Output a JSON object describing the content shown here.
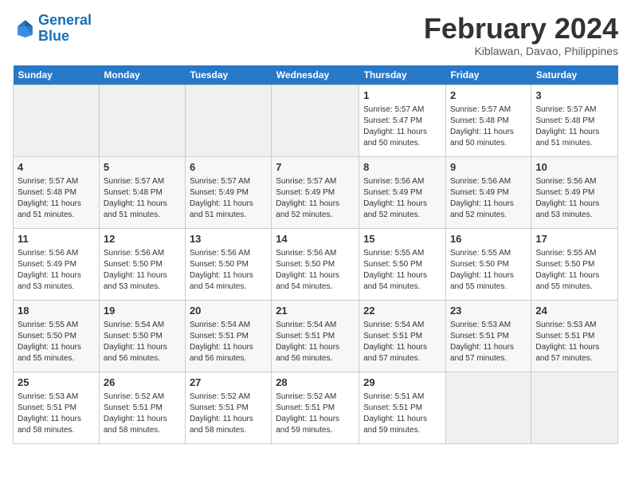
{
  "header": {
    "logo_line1": "General",
    "logo_line2": "Blue",
    "month": "February 2024",
    "location": "Kiblawan, Davao, Philippines"
  },
  "weekdays": [
    "Sunday",
    "Monday",
    "Tuesday",
    "Wednesday",
    "Thursday",
    "Friday",
    "Saturday"
  ],
  "weeks": [
    [
      {
        "day": "",
        "empty": true
      },
      {
        "day": "",
        "empty": true
      },
      {
        "day": "",
        "empty": true
      },
      {
        "day": "",
        "empty": true
      },
      {
        "day": "1",
        "rise": "5:57 AM",
        "set": "5:47 PM",
        "daylight": "11 hours and 50 minutes."
      },
      {
        "day": "2",
        "rise": "5:57 AM",
        "set": "5:48 PM",
        "daylight": "11 hours and 50 minutes."
      },
      {
        "day": "3",
        "rise": "5:57 AM",
        "set": "5:48 PM",
        "daylight": "11 hours and 51 minutes."
      }
    ],
    [
      {
        "day": "4",
        "rise": "5:57 AM",
        "set": "5:48 PM",
        "daylight": "11 hours and 51 minutes."
      },
      {
        "day": "5",
        "rise": "5:57 AM",
        "set": "5:48 PM",
        "daylight": "11 hours and 51 minutes."
      },
      {
        "day": "6",
        "rise": "5:57 AM",
        "set": "5:49 PM",
        "daylight": "11 hours and 51 minutes."
      },
      {
        "day": "7",
        "rise": "5:57 AM",
        "set": "5:49 PM",
        "daylight": "11 hours and 52 minutes."
      },
      {
        "day": "8",
        "rise": "5:56 AM",
        "set": "5:49 PM",
        "daylight": "11 hours and 52 minutes."
      },
      {
        "day": "9",
        "rise": "5:56 AM",
        "set": "5:49 PM",
        "daylight": "11 hours and 52 minutes."
      },
      {
        "day": "10",
        "rise": "5:56 AM",
        "set": "5:49 PM",
        "daylight": "11 hours and 53 minutes."
      }
    ],
    [
      {
        "day": "11",
        "rise": "5:56 AM",
        "set": "5:49 PM",
        "daylight": "11 hours and 53 minutes."
      },
      {
        "day": "12",
        "rise": "5:56 AM",
        "set": "5:50 PM",
        "daylight": "11 hours and 53 minutes."
      },
      {
        "day": "13",
        "rise": "5:56 AM",
        "set": "5:50 PM",
        "daylight": "11 hours and 54 minutes."
      },
      {
        "day": "14",
        "rise": "5:56 AM",
        "set": "5:50 PM",
        "daylight": "11 hours and 54 minutes."
      },
      {
        "day": "15",
        "rise": "5:55 AM",
        "set": "5:50 PM",
        "daylight": "11 hours and 54 minutes."
      },
      {
        "day": "16",
        "rise": "5:55 AM",
        "set": "5:50 PM",
        "daylight": "11 hours and 55 minutes."
      },
      {
        "day": "17",
        "rise": "5:55 AM",
        "set": "5:50 PM",
        "daylight": "11 hours and 55 minutes."
      }
    ],
    [
      {
        "day": "18",
        "rise": "5:55 AM",
        "set": "5:50 PM",
        "daylight": "11 hours and 55 minutes."
      },
      {
        "day": "19",
        "rise": "5:54 AM",
        "set": "5:50 PM",
        "daylight": "11 hours and 56 minutes."
      },
      {
        "day": "20",
        "rise": "5:54 AM",
        "set": "5:51 PM",
        "daylight": "11 hours and 56 minutes."
      },
      {
        "day": "21",
        "rise": "5:54 AM",
        "set": "5:51 PM",
        "daylight": "11 hours and 56 minutes."
      },
      {
        "day": "22",
        "rise": "5:54 AM",
        "set": "5:51 PM",
        "daylight": "11 hours and 57 minutes."
      },
      {
        "day": "23",
        "rise": "5:53 AM",
        "set": "5:51 PM",
        "daylight": "11 hours and 57 minutes."
      },
      {
        "day": "24",
        "rise": "5:53 AM",
        "set": "5:51 PM",
        "daylight": "11 hours and 57 minutes."
      }
    ],
    [
      {
        "day": "25",
        "rise": "5:53 AM",
        "set": "5:51 PM",
        "daylight": "11 hours and 58 minutes."
      },
      {
        "day": "26",
        "rise": "5:52 AM",
        "set": "5:51 PM",
        "daylight": "11 hours and 58 minutes."
      },
      {
        "day": "27",
        "rise": "5:52 AM",
        "set": "5:51 PM",
        "daylight": "11 hours and 58 minutes."
      },
      {
        "day": "28",
        "rise": "5:52 AM",
        "set": "5:51 PM",
        "daylight": "11 hours and 59 minutes."
      },
      {
        "day": "29",
        "rise": "5:51 AM",
        "set": "5:51 PM",
        "daylight": "11 hours and 59 minutes."
      },
      {
        "day": "",
        "empty": true
      },
      {
        "day": "",
        "empty": true
      }
    ]
  ]
}
